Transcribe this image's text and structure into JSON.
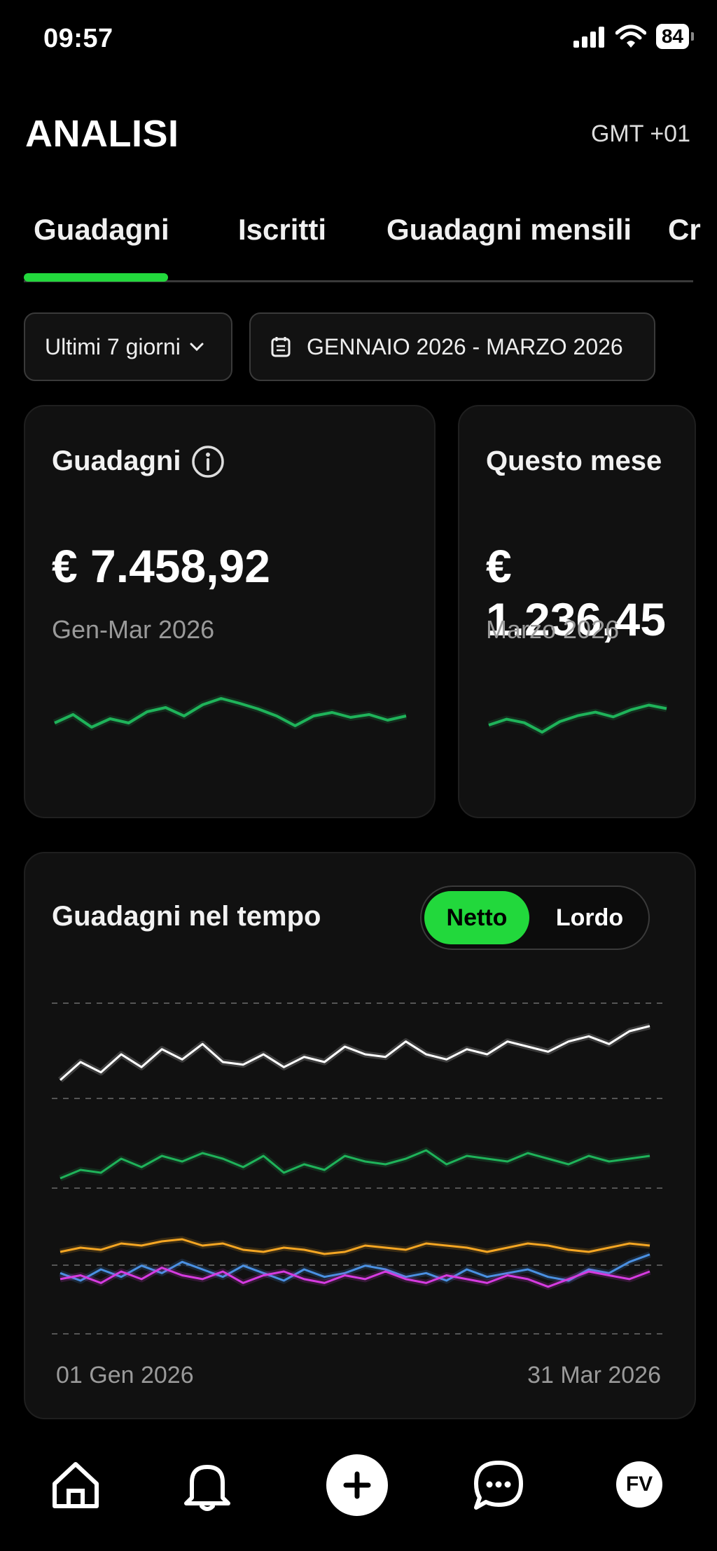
{
  "status_bar": {
    "time": "09:57",
    "battery": "84"
  },
  "header": {
    "title": "ANALISI",
    "timezone": "GMT +01"
  },
  "tabs": [
    {
      "label": "Guadagni",
      "active": true
    },
    {
      "label": "Iscritti"
    },
    {
      "label": "Guadagni mensili"
    },
    {
      "label": "Cr"
    }
  ],
  "filters": {
    "range_select": "Ultimi 7 giorni",
    "date_range": "GENNAIO 2026 - MARZO 2026"
  },
  "cards": [
    {
      "title": "Guadagni",
      "amount": "€ 7.458,92",
      "subtitle": "Gen-Mar 2026"
    },
    {
      "title": "Questo mese",
      "amount": "€ 1.236,45",
      "subtitle": "Marzo 2026"
    }
  ],
  "chart_section": {
    "title": "Guadagni nel tempo",
    "toggle": {
      "selected": "Netto",
      "other": "Lordo"
    },
    "x_start_label": "01 Gen 2026",
    "x_end_label": "31 Mar 2026"
  },
  "colors": {
    "accent": "#22d83c",
    "series_white": "#ffffff",
    "series_green": "#1fb35a",
    "series_orange": "#f5a623",
    "series_blue": "#4a90e2",
    "series_magenta": "#d63be0"
  },
  "bottom_nav": [
    {
      "icon": "home-icon"
    },
    {
      "icon": "bell-icon"
    },
    {
      "icon": "plus-icon"
    },
    {
      "icon": "chat-icon"
    },
    {
      "icon": "avatar",
      "initials": "FV"
    }
  ],
  "chart_data": [
    {
      "type": "line",
      "series": [
        {
          "values": [
            40,
            52,
            34,
            46,
            40,
            56,
            62,
            50,
            66,
            75,
            68,
            60,
            50,
            36,
            50,
            55,
            48,
            52,
            44,
            50
          ]
        }
      ]
    },
    {
      "type": "line",
      "series": [
        {
          "values": [
            44,
            54,
            48,
            32,
            50,
            60,
            66,
            58,
            70,
            78,
            72
          ]
        }
      ]
    },
    {
      "type": "line",
      "series": [
        {
          "values": [
            10,
            24,
            16,
            30,
            20,
            34,
            26,
            38,
            24,
            22,
            30,
            20,
            28,
            24,
            36,
            30,
            28,
            40,
            30,
            26,
            34,
            30,
            40,
            36,
            32,
            40,
            44,
            38,
            48,
            52
          ]
        },
        {
          "values": [
            14,
            20,
            18,
            28,
            22,
            30,
            26,
            32,
            28,
            22,
            30,
            18,
            24,
            20,
            30,
            26,
            24,
            28,
            34,
            24,
            30,
            28,
            26,
            32,
            28,
            24,
            30,
            26,
            28,
            30
          ]
        },
        {
          "values": [
            22,
            26,
            24,
            30,
            28,
            32,
            34,
            28,
            30,
            24,
            22,
            26,
            24,
            20,
            22,
            28,
            26,
            24,
            30,
            28,
            26,
            22,
            26,
            30,
            28,
            24,
            22,
            26,
            30,
            28
          ]
        },
        {
          "values": [
            16,
            12,
            18,
            14,
            20,
            16,
            22,
            18,
            14,
            20,
            16,
            12,
            18,
            14,
            16,
            20,
            18,
            14,
            16,
            12,
            18,
            14,
            16,
            18,
            14,
            12,
            18,
            16,
            22,
            26
          ]
        },
        {
          "values": [
            14,
            16,
            12,
            18,
            14,
            20,
            16,
            14,
            18,
            12,
            16,
            18,
            14,
            12,
            16,
            14,
            18,
            14,
            12,
            16,
            14,
            12,
            16,
            14,
            10,
            14,
            18,
            16,
            14,
            18
          ]
        }
      ]
    }
  ]
}
